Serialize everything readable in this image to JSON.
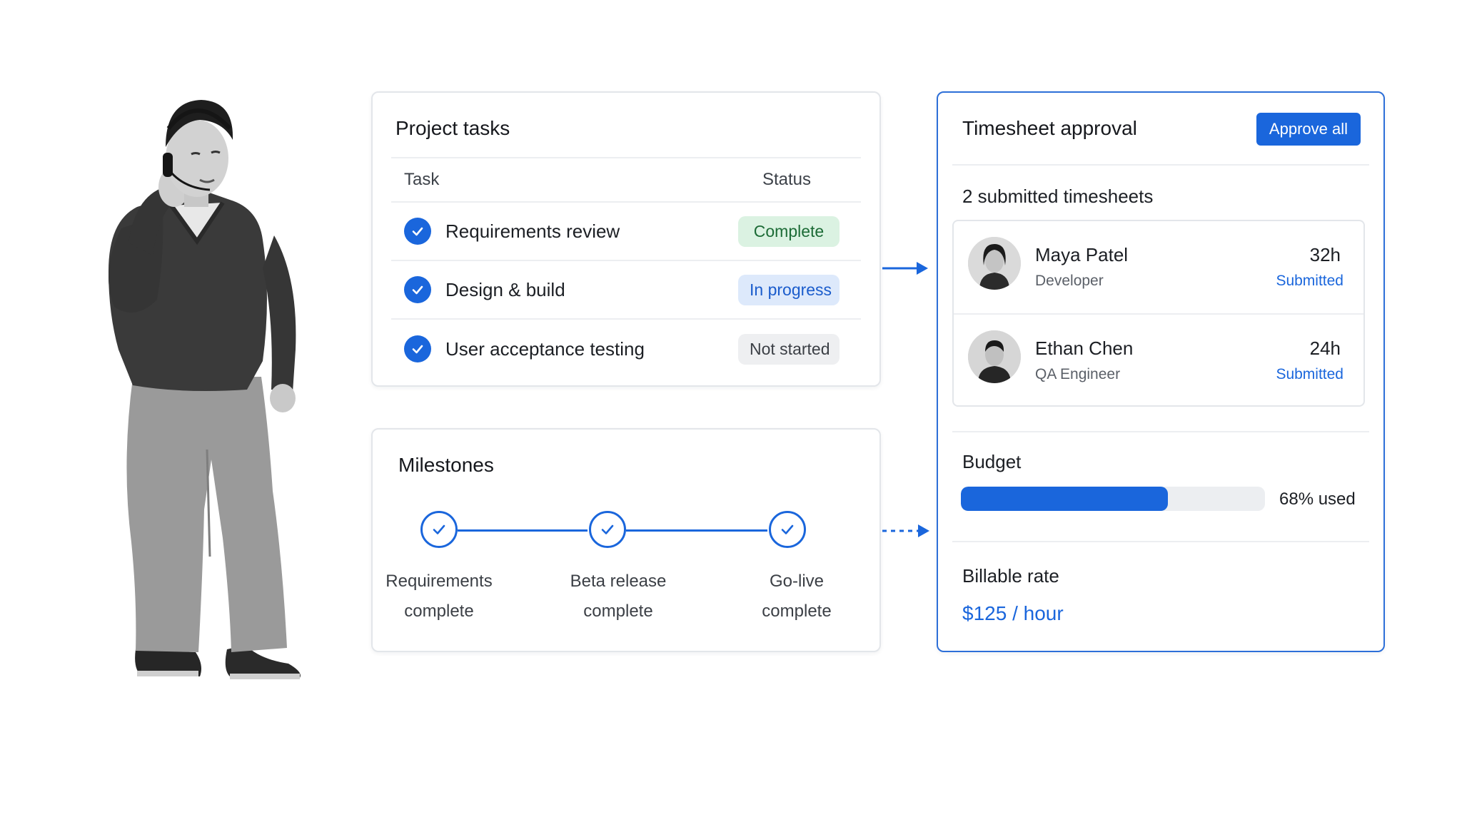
{
  "project_tasks": {
    "title": "Project tasks",
    "columns": {
      "task": "Task",
      "status": "Status"
    },
    "rows": [
      {
        "task": "Requirements review",
        "status": "Complete",
        "tone": "green"
      },
      {
        "task": "Design & build",
        "status": "In progress",
        "tone": "blue"
      },
      {
        "task": "User acceptance testing",
        "status": "Not started",
        "tone": "gray"
      }
    ]
  },
  "milestones": {
    "title": "Milestones",
    "items": [
      {
        "line1": "Requirements",
        "line2": "complete"
      },
      {
        "line1": "Beta release",
        "line2": "complete"
      },
      {
        "line1": "Go-live",
        "line2": "complete"
      }
    ]
  },
  "timesheet": {
    "title": "Timesheet approval",
    "approve_label": "Approve all",
    "submitted_count": "2 submitted timesheets",
    "entries": [
      {
        "name": "Maya Patel",
        "role": "Developer",
        "hours": "32h",
        "status": "Submitted"
      },
      {
        "name": "Ethan Chen",
        "role": "QA Engineer",
        "hours": "24h",
        "status": "Submitted"
      }
    ],
    "budget": {
      "label": "Budget",
      "used_fraction": 0.68,
      "used_label": "68% used"
    },
    "billable": {
      "label": "Billable rate",
      "value": "$125 / hour"
    }
  },
  "colors": {
    "accent": "#1a66dc",
    "complete": "#1c6b36",
    "in_progress": "#1a5ccc"
  },
  "icons": {
    "task_done": "check-circle-icon",
    "milestone": "check-icon"
  }
}
